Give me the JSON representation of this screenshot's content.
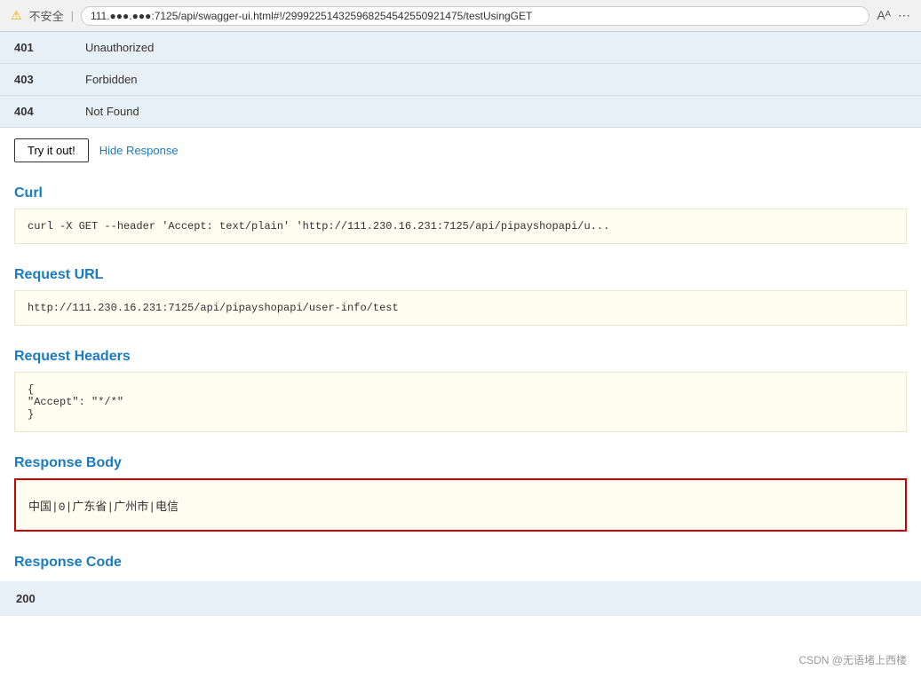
{
  "browser": {
    "warning_icon": "⚠",
    "insecure_label": "不安全",
    "separator": "|",
    "url": "111.●●●.●●●:7125/api/swagger-ui.html#!/29992251432596825454255092147​5/testUsingGET",
    "font_icon_a": "A",
    "font_icon_b": "ᴬ"
  },
  "responses": {
    "rows": [
      {
        "code": "401",
        "description": "Unauthorized"
      },
      {
        "code": "403",
        "description": "Forbidden"
      },
      {
        "code": "404",
        "description": "Not Found"
      }
    ]
  },
  "buttons": {
    "try_it_out": "Try it out!",
    "hide_response": "Hide Response"
  },
  "curl_section": {
    "title": "Curl",
    "code": "curl -X GET --header 'Accept: text/plain' 'http://111.230.16.231:7125/api/pipayshopapi/u..."
  },
  "request_url_section": {
    "title": "Request URL",
    "url": "http://111.230.16.231:7125/api/pipayshopapi/user-info/test"
  },
  "request_headers_section": {
    "title": "Request Headers",
    "code_line1": "{",
    "code_line2": "  \"Accept\": \"*/*\"",
    "code_line3": "}"
  },
  "response_body_section": {
    "title": "Response Body",
    "content": "中国|0|广东省|广州市|电信"
  },
  "response_code_section": {
    "title": "Response Code",
    "code": "200"
  },
  "watermark": {
    "text": "CSDN @无语堵上西楼"
  }
}
